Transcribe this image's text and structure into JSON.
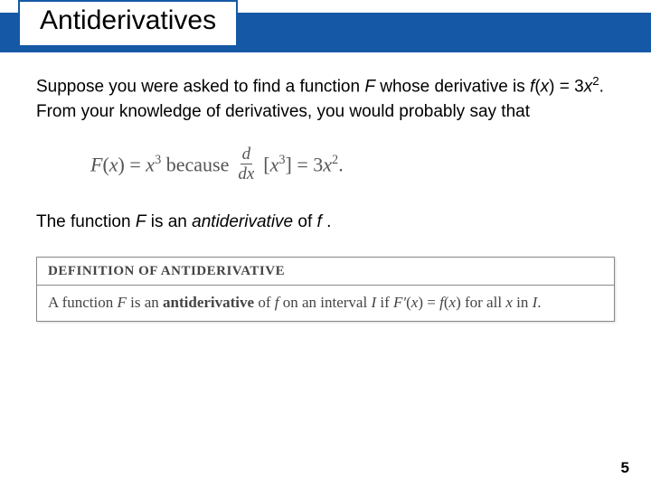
{
  "title": "Antiderivatives",
  "para1": {
    "t1": "Suppose you were asked to find a function ",
    "F": "F",
    "t2": " whose derivative is ",
    "fx": "f",
    "open": "(",
    "x": "x",
    "close": ")",
    "eq": " = 3",
    "x2": "x",
    "sq": "2",
    "t3": ". From your knowledge of derivatives, you would probably say that"
  },
  "equation": {
    "Fx": "F",
    "open": "(",
    "x": "x",
    "close": ")",
    "eq1": " = ",
    "x3a": "x",
    "cube": "3",
    "because": " because ",
    "d": "d",
    "dx": "dx",
    "lb": "[",
    "x3b": "x",
    "cube2": "3",
    "rb": "]",
    "eq2": " = 3",
    "x2": "x",
    "sq": "2",
    "dot": "."
  },
  "para2": {
    "t1": "The function ",
    "F": "F",
    "t2": " is an ",
    "anti": "antiderivative",
    "t3": " of ",
    "f": "f",
    "t4": " ."
  },
  "defbox": {
    "heading": "DEFINITION OF ANTIDERIVATIVE",
    "b1": "A function ",
    "F": "F",
    "b2": " is an ",
    "anti": "antiderivative",
    "b3": " of ",
    "f": "f",
    "b4": " on an interval ",
    "I": "I",
    "b5": " if ",
    "Fp": "F′",
    "open": "(",
    "x1": "x",
    "close": ")",
    "eq": " = ",
    "f2": "f",
    "open2": "(",
    "x2": "x",
    "close2": ")",
    "b6": " for all ",
    "x3": "x",
    "b7": " in ",
    "I2": "I",
    "dot": "."
  },
  "pagenum": "5"
}
